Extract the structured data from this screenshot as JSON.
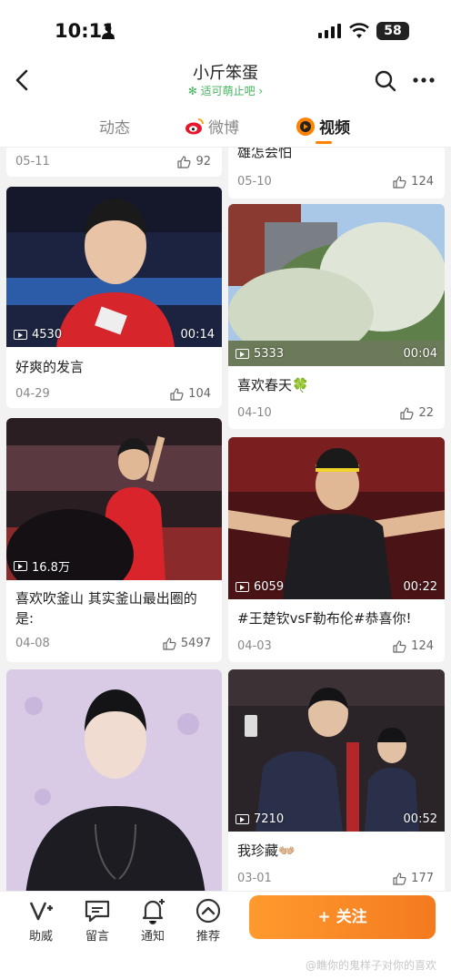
{
  "status_bar": {
    "time": "10:11",
    "battery": "58"
  },
  "header": {
    "title": "小斤笨蛋",
    "subtitle": "✻ 适可萌止吧 ›"
  },
  "tabs": [
    {
      "label": "动态",
      "active": false
    },
    {
      "label": "微博",
      "active": false
    },
    {
      "label": "视频",
      "active": true
    }
  ],
  "videos": {
    "top_left": {
      "date": "05-11",
      "likes": "92"
    },
    "top_right": {
      "caption": "雄怎会怕",
      "date": "05-10",
      "likes": "124"
    },
    "v1": {
      "views": "4530",
      "duration": "00:14",
      "caption": "好爽的发言",
      "date": "04-29",
      "likes": "104"
    },
    "v2": {
      "views": "5333",
      "duration": "00:04",
      "caption": "喜欢春天🍀",
      "date": "04-10",
      "likes": "22"
    },
    "v3": {
      "views": "16.8万",
      "caption": "喜欢吹釜山 其实釜山最出圈的是:",
      "date": "04-08",
      "likes": "5497"
    },
    "v4": {
      "views": "6059",
      "duration": "00:22",
      "caption": "#王楚钦vsF勒布伦#恭喜你!",
      "date": "04-03",
      "likes": "124"
    },
    "v6": {
      "views": "7210",
      "duration": "00:52",
      "caption": "我珍藏👐🏼",
      "date": "03-01",
      "likes": "177"
    }
  },
  "bottom_bar": {
    "items": [
      {
        "label": "助威",
        "icon": "cheer-icon"
      },
      {
        "label": "留言",
        "icon": "message-icon"
      },
      {
        "label": "通知",
        "icon": "bell-icon"
      },
      {
        "label": "推荐",
        "icon": "recommend-icon"
      }
    ],
    "follow_label": "+ 关注",
    "watermark": "@瞧你的鬼样子对你的喜欢"
  },
  "colors": {
    "accent": "#ff8200",
    "follow_start": "#ff9a2e",
    "follow_end": "#f47a1f",
    "green": "#3fb55a"
  }
}
